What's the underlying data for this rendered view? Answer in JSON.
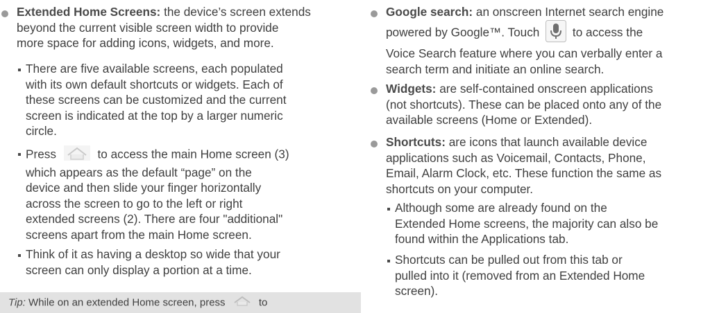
{
  "left": {
    "extended_title": "Extended Home Screens:",
    "extended_text_1": "the device’s screen extends",
    "extended_text_2": "beyond the current visible screen width to provide",
    "extended_text_3": "more space for adding icons, widgets, and more.",
    "sub1_lines": [
      "There are five available screens, each populated",
      "with its own default shortcuts or widgets. Each of",
      "these screens can be customized and the current",
      "screen is indicated at the top by a larger numeric",
      "circle."
    ],
    "sub2_press": "Press",
    "sub2_after_icon": "to access the main Home screen (3)",
    "sub2_lines": [
      "which appears as the default “page” on the",
      "device and then slide your finger horizontally",
      "across the screen to go to the left or right",
      "extended screens (2). There are four \"additional\"",
      "screens apart from the main Home screen."
    ],
    "sub3_lines": [
      "Think of it as having a desktop so wide that your",
      "screen can only display a portion at a time."
    ],
    "tip_label": "Tip:",
    "tip_text_before": "While on an extended Home screen, press",
    "tip_text_after": "to"
  },
  "right": {
    "google_title": "Google search:",
    "google_text_1": "an onscreen Internet search engine",
    "google_text_2a": "powered by Google™. Touch",
    "google_text_2b": "to access the",
    "google_text_3": "Voice Search feature where you can verbally enter a",
    "google_text_4": "search term and initiate an online search.",
    "widgets_title": "Widgets:",
    "widgets_lines": [
      "are self-contained onscreen applications",
      "(not shortcuts). These can be placed onto any of the",
      "available screens (Home or Extended)."
    ],
    "shortcuts_title": "Shortcuts:",
    "shortcuts_lines": [
      "are icons that launch available device",
      "applications such as Voicemail, Contacts, Phone,",
      "Email, Alarm Clock, etc. These function the same as",
      "shortcuts on your computer."
    ],
    "sc_sub1_lines": [
      "Although some are already found on the",
      "Extended Home screens, the majority can also be",
      "found within the Applications tab."
    ],
    "sc_sub2_lines": [
      "Shortcuts can be pulled out from this tab or",
      "pulled into it (removed from an Extended Home",
      "screen)."
    ]
  },
  "icons": {
    "home": "home-icon",
    "mic": "microphone-icon"
  }
}
